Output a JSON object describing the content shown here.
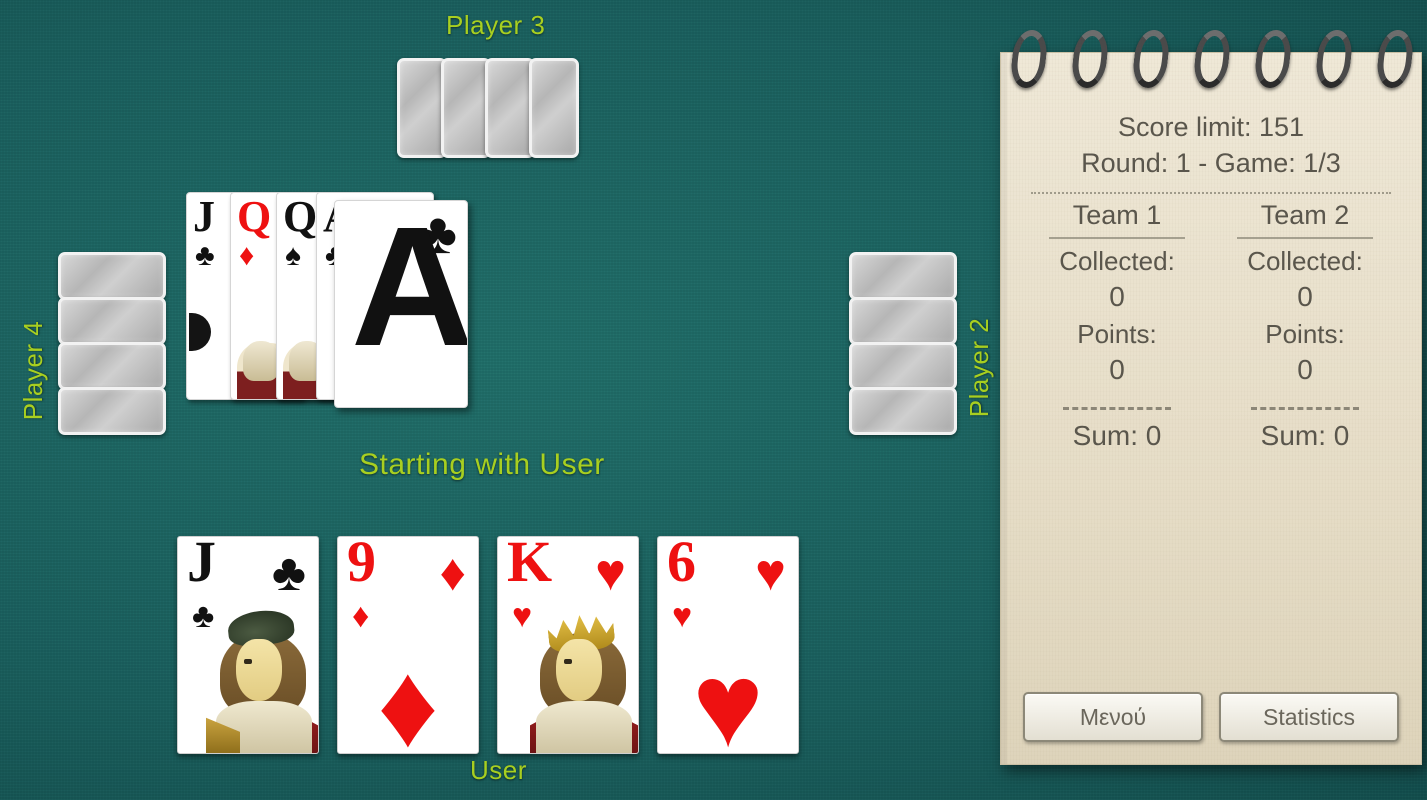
{
  "table": {
    "felt_color": "#1b6260",
    "label_color": "#a8cf20"
  },
  "players": {
    "top": {
      "label": "Player 3",
      "card_back_count": 4
    },
    "left": {
      "label": "Player 4",
      "card_back_count": 4
    },
    "right": {
      "label": "Player 2",
      "card_back_count": 4
    },
    "bottom": {
      "label": "User"
    }
  },
  "status": {
    "turn_text": "Starting with User"
  },
  "hand": {
    "cards": [
      {
        "rank": "J",
        "suit": "♣",
        "color": "black",
        "has_court": true,
        "court_type": "jack"
      },
      {
        "rank": "9",
        "suit": "♦",
        "color": "red",
        "has_court": false,
        "court_type": ""
      },
      {
        "rank": "K",
        "suit": "♥",
        "color": "red",
        "has_court": true,
        "court_type": "king"
      },
      {
        "rank": "6",
        "suit": "♥",
        "color": "red",
        "has_court": false,
        "court_type": ""
      }
    ]
  },
  "trick": {
    "fanned_cards": [
      {
        "rank": "J",
        "suit": "♣",
        "color": "black"
      },
      {
        "rank": "Q",
        "suit": "♦",
        "color": "red"
      },
      {
        "rank": "Q",
        "suit": "♠",
        "color": "black"
      },
      {
        "rank": "A",
        "suit": "♣",
        "color": "black"
      }
    ],
    "top_card": {
      "rank": "A",
      "suit": "♣",
      "color": "black"
    }
  },
  "notepad": {
    "score_limit": "Score limit: 151",
    "round_game": "Round: 1 - Game: 1/3",
    "teams": [
      {
        "name": "Team 1",
        "collected_label": "Collected:",
        "collected_value": "0",
        "points_label": "Points:",
        "points_value": "0",
        "sum": "Sum: 0"
      },
      {
        "name": "Team 2",
        "collected_label": "Collected:",
        "collected_value": "0",
        "points_label": "Points:",
        "points_value": "0",
        "sum": "Sum: 0"
      }
    ],
    "buttons": {
      "menu": "Μενού",
      "statistics": "Statistics"
    },
    "spiral_ring_count": 7
  }
}
